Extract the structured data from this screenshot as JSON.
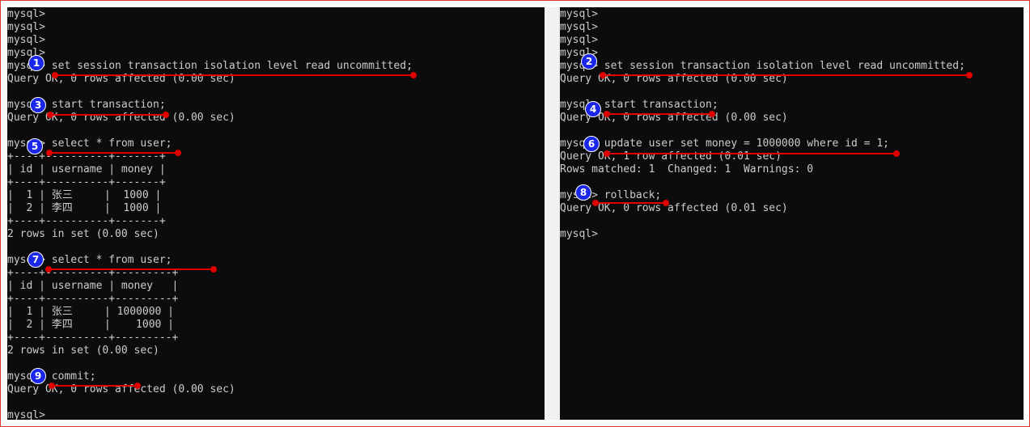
{
  "left_terminal": {
    "lines": [
      "mysql>",
      "mysql>",
      "mysql>",
      "mysql>",
      "mysql> set session transaction isolation level read uncommitted;",
      "Query OK, 0 rows affected (0.00 sec)",
      "",
      "mysql> start transaction;",
      "Query OK, 0 rows affected (0.00 sec)",
      "",
      "mysql> select * from user;",
      "+----+----------+-------+",
      "| id | username | money |",
      "+----+----------+-------+",
      "|  1 | 张三     |  1000 |",
      "|  2 | 李四     |  1000 |",
      "+----+----------+-------+",
      "2 rows in set (0.00 sec)",
      "",
      "mysql> select * from user;",
      "+----+----------+---------+",
      "| id | username | money   |",
      "+----+----------+---------+",
      "|  1 | 张三     | 1000000 |",
      "|  2 | 李四     |    1000 |",
      "+----+----------+---------+",
      "2 rows in set (0.00 sec)",
      "",
      "mysql> commit;",
      "Query OK, 0 rows affected (0.00 sec)",
      "",
      "mysql> "
    ]
  },
  "right_terminal": {
    "lines": [
      "mysql>",
      "mysql>",
      "mysql>",
      "mysql>",
      "mysql> set session transaction isolation level read uncommitted;",
      "Query OK, 0 rows affected (0.00 sec)",
      "",
      "mysql> start transaction;",
      "Query OK, 0 rows affected (0.00 sec)",
      "",
      "mysql> update user set money = 1000000 where id = 1;",
      "Query OK, 1 row affected (0.01 sec)",
      "Rows matched: 1  Changed: 1  Warnings: 0",
      "",
      "mysql> rollback;",
      "Query OK, 0 rows affected (0.01 sec)",
      "",
      "mysql>"
    ]
  },
  "badges": [
    "1",
    "2",
    "3",
    "4",
    "5",
    "6",
    "7",
    "8",
    "9"
  ],
  "colors": {
    "annotation_line": "#e10000",
    "badge": "#1b27e8",
    "terminal_bg": "#0c0c0c",
    "terminal_text": "#cccccc"
  }
}
